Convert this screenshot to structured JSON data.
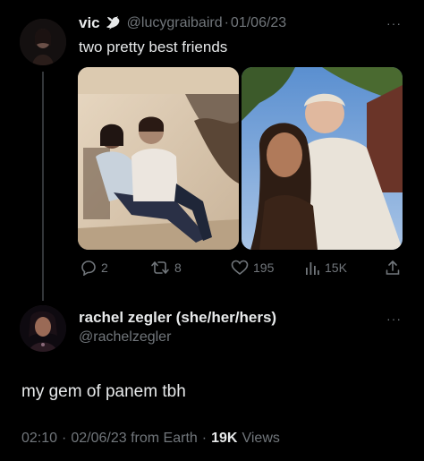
{
  "parent_tweet": {
    "display_name": "vic",
    "badge_icon": "dove-icon",
    "handle": "@lucygraibaird",
    "separator": "·",
    "date": "01/06/23",
    "text": "two pretty best friends",
    "actions": {
      "replies": "2",
      "retweets": "8",
      "likes": "195",
      "views": "15K"
    }
  },
  "reply_tweet": {
    "display_name": "rachel zegler (she/her/hers)",
    "handle": "@rachelzegler",
    "text": "my gem of panem tbh",
    "time": "02:10",
    "separator": "·",
    "date": "02/06/23 from Earth",
    "separator2": "·",
    "views_count": "19K",
    "views_label": "Views"
  },
  "more_icon": "···",
  "colors": {
    "background": "#000000",
    "text": "#e7e9ea",
    "muted": "#71767b",
    "thread_line": "#333639"
  }
}
